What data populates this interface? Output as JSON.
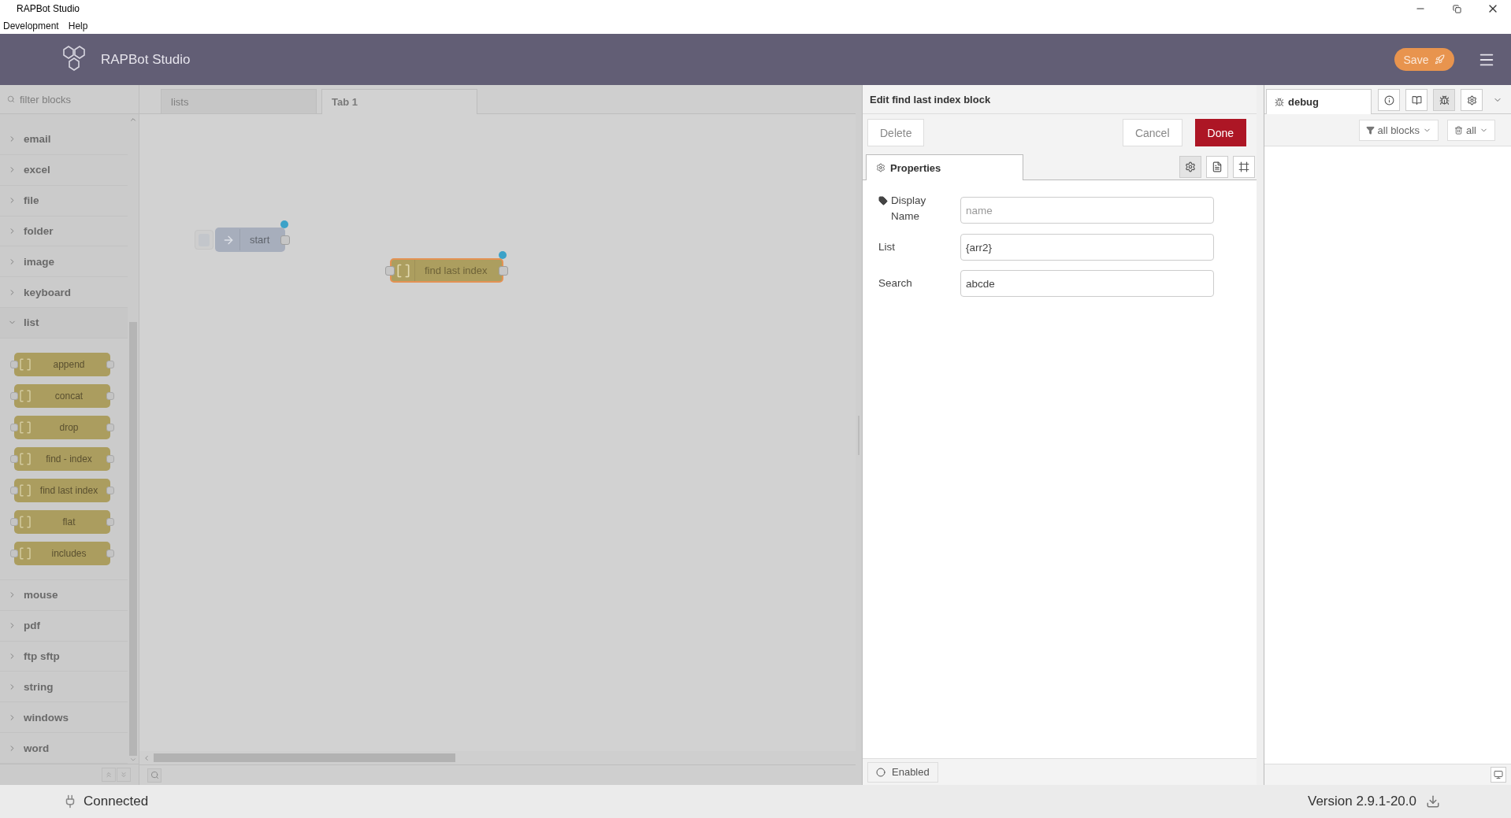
{
  "window": {
    "title": "RAPBot Studio"
  },
  "menu": [
    "Development",
    "Help"
  ],
  "header": {
    "title": "RAPBot Studio",
    "save_button": "Save"
  },
  "palette": {
    "filter_placeholder": "filter blocks",
    "categories": [
      {
        "label": "email",
        "expanded": false
      },
      {
        "label": "excel",
        "expanded": false
      },
      {
        "label": "file",
        "expanded": false
      },
      {
        "label": "folder",
        "expanded": false
      },
      {
        "label": "image",
        "expanded": false
      },
      {
        "label": "keyboard",
        "expanded": false
      },
      {
        "label": "list",
        "expanded": true,
        "blocks": [
          "append",
          "concat",
          "drop",
          "find - index",
          "find last index",
          "flat",
          "includes"
        ]
      },
      {
        "label": "mouse",
        "expanded": false
      },
      {
        "label": "pdf",
        "expanded": false
      },
      {
        "label": "ftp sftp",
        "expanded": false
      },
      {
        "label": "string",
        "expanded": false
      },
      {
        "label": "windows",
        "expanded": false
      },
      {
        "label": "word",
        "expanded": false
      }
    ]
  },
  "workspace": {
    "tabs": [
      {
        "label": "lists",
        "selected": false
      },
      {
        "label": "Tab 1",
        "selected": true
      }
    ],
    "nodes": [
      {
        "label": "start",
        "kind": "inject",
        "selected": false,
        "changed": true
      },
      {
        "label": "find last index",
        "kind": "list",
        "selected": true,
        "changed": true
      }
    ]
  },
  "editor": {
    "title": "Edit find last index block",
    "delete_button": "Delete",
    "cancel_button": "Cancel",
    "done_button": "Done",
    "tabs": [
      {
        "label": "Properties",
        "selected": true
      }
    ],
    "icon_tabs": [
      {
        "kind": "settings",
        "selected": true
      },
      {
        "kind": "description",
        "selected": false
      },
      {
        "kind": "appearance",
        "selected": false
      }
    ],
    "fields": [
      {
        "label": "Display Name",
        "placeholder": "name"
      },
      {
        "label": "List",
        "value": "{arr2}"
      },
      {
        "label": "Search",
        "value": "abcde"
      }
    ],
    "enabled_button": "Enabled"
  },
  "sidebar": {
    "tabs": [
      {
        "label": "debug",
        "selected": true
      }
    ],
    "icon_tabs": [
      {
        "kind": "info",
        "selected": false
      },
      {
        "kind": "book",
        "selected": false
      },
      {
        "kind": "bug",
        "selected": true
      },
      {
        "kind": "settings",
        "selected": false
      }
    ],
    "filter_button": "all blocks",
    "clear_button": "all"
  },
  "status_bar": {
    "connection": "Connected",
    "version": "Version 2.9.1-20.0"
  }
}
